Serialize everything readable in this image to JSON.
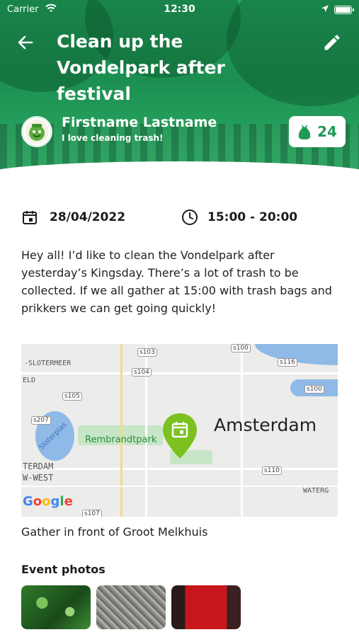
{
  "status_bar": {
    "carrier": "Carrier",
    "time": "12:30"
  },
  "header": {
    "title": "Clean up the Vondelpark after festival",
    "user_name": "Firstname Lastname",
    "user_tagline": "I love cleaning trash!",
    "trash_count": "24"
  },
  "event": {
    "date": "28/04/2022",
    "time": "15:00 - 20:00",
    "description": "Hey all! I’d like to clean the Vondelpark after yesterday’s Kingsday. There’s a lot of trash to be collected. If we all gather at 15:00 with trash bags and prikkers we can get going quickly!",
    "location_caption": "Gather in front of Groot Melkhuis"
  },
  "map": {
    "city_label": "Amsterdam",
    "park_label": "Rembrandtpark",
    "water_label": "Sloterplas",
    "labels": [
      "-SLOTERMEER",
      "ELD",
      "TERDAM",
      "W-WEST",
      "WATERG"
    ],
    "shields": [
      "s100",
      "s103",
      "s104",
      "s116",
      "s105",
      "s100",
      "s207",
      "s110",
      "s107"
    ],
    "attribution": "Google"
  },
  "photos": {
    "title": "Event photos"
  },
  "colors": {
    "brand_green": "#1f9a55",
    "pin_green": "#7bc11f"
  }
}
